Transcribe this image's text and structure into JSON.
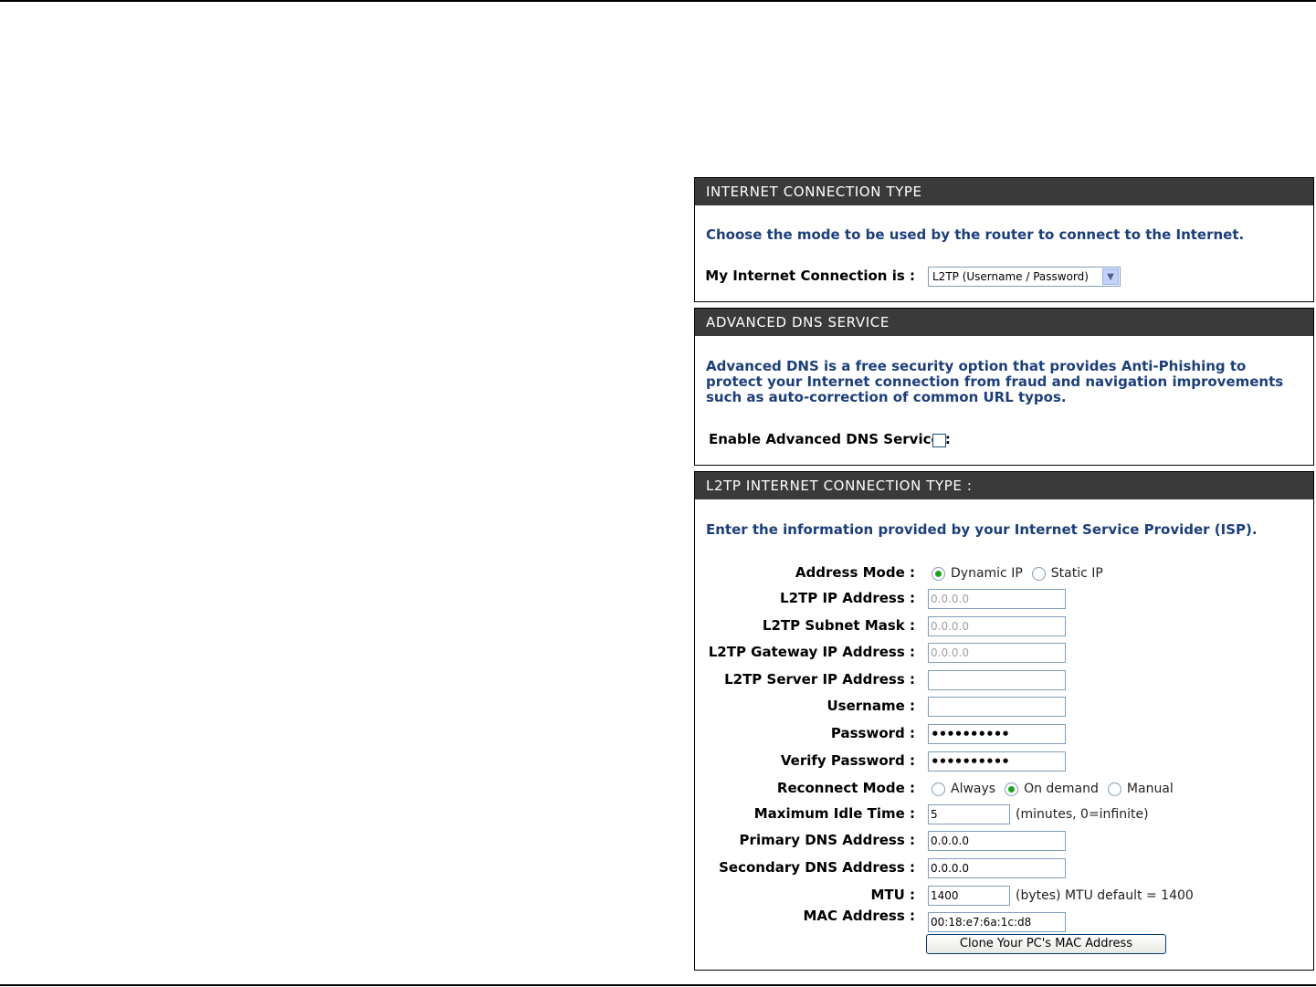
{
  "internet_connection": {
    "header": "INTERNET CONNECTION TYPE",
    "description": "Choose the mode to be used by the router to connect to the Internet.",
    "connection_label": "My Internet Connection is :",
    "connection_value": "L2TP (Username / Password)"
  },
  "advanced_dns": {
    "header": "ADVANCED DNS SERVICE",
    "description": "Advanced DNS is a free security option that provides Anti-Phishing to protect your Internet connection from fraud and navigation improvements such as auto-correction of common URL typos.",
    "enable_label": "Enable Advanced DNS Service :",
    "enabled": false
  },
  "l2tp": {
    "header": "L2TP INTERNET CONNECTION TYPE :",
    "description": "Enter the information provided by your Internet Service Provider (ISP).",
    "address_mode_label": "Address Mode :",
    "address_mode_options": [
      "Dynamic IP",
      "Static IP"
    ],
    "address_mode_selected": "Dynamic IP",
    "ip_address_label": "L2TP IP Address :",
    "ip_address_value": "0.0.0.0",
    "subnet_mask_label": "L2TP Subnet Mask :",
    "subnet_mask_value": "0.0.0.0",
    "gateway_label": "L2TP Gateway IP Address :",
    "gateway_value": "0.0.0.0",
    "server_label": "L2TP Server IP Address :",
    "server_value": "",
    "username_label": "Username :",
    "username_value": "",
    "password_label": "Password :",
    "password_value": "••••••••••",
    "verify_password_label": "Verify Password :",
    "verify_password_value": "••••••••••",
    "reconnect_label": "Reconnect Mode :",
    "reconnect_options": [
      "Always",
      "On demand",
      "Manual"
    ],
    "reconnect_selected": "On demand",
    "idle_time_label": "Maximum Idle Time :",
    "idle_time_value": "5",
    "idle_time_hint": "(minutes, 0=infinite)",
    "primary_dns_label": "Primary DNS Address :",
    "primary_dns_value": "0.0.0.0",
    "secondary_dns_label": "Secondary DNS Address :",
    "secondary_dns_value": "0.0.0.0",
    "mtu_label": "MTU :",
    "mtu_value": "1400",
    "mtu_hint": "(bytes) MTU default = 1400",
    "mac_label": "MAC Address :",
    "mac_value": "00:18:e7:6a:1c:d8",
    "clone_button": "Clone Your PC's MAC Address"
  },
  "colors": {
    "header_bg": "#3a3a3a",
    "description_text": "#1c3f7a",
    "radio_selected": "#21a121"
  },
  "icons": [
    "chevron-down-icon"
  ]
}
